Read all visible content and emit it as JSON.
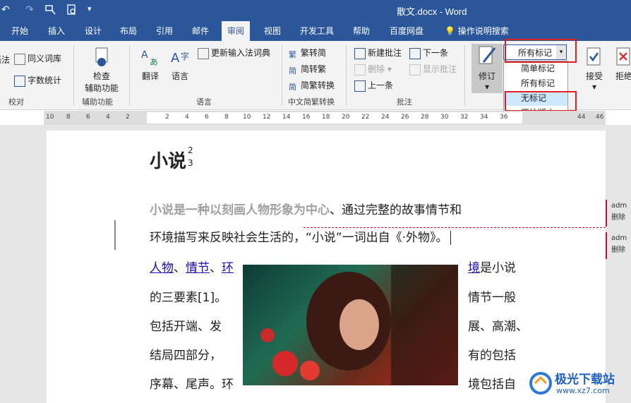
{
  "titlebar": {
    "undo": "↶",
    "redo": "↷",
    "doc_title": "散文.docx  -  Word"
  },
  "tabs": [
    "开始",
    "插入",
    "设计",
    "布局",
    "引用",
    "邮件",
    "审阅",
    "视图",
    "开发工具",
    "帮助",
    "百度网盘",
    "操作说明搜索"
  ],
  "ribbon": {
    "proofing": {
      "thesaurus": "同义词库",
      "wordcount": "字数统计",
      "grammar": "语法",
      "group": "校对"
    },
    "accessibility": {
      "check": "检查",
      "check2": "辅助功能",
      "group": "辅助功能"
    },
    "language": {
      "translate": "翻译",
      "language": "语言",
      "ime": "更新输入法词典",
      "group": "语言"
    },
    "chinese": {
      "t2s": "繁转简",
      "s2t": "简转繁",
      "convert": "简繁转换",
      "group": "中文简繁转换"
    },
    "comments": {
      "new": "新建批注",
      "delete": "删除",
      "prev": "上一条",
      "next": "下一条",
      "show": "显示批注",
      "group": "批注"
    },
    "tracking": {
      "track": "修订",
      "select_value": "所有标记",
      "simple": "简单标记",
      "all": "所有标记",
      "none": "无标记",
      "original": "原始版本",
      "partial": "修"
    },
    "changes": {
      "accept": "接受",
      "reject": "拒绝"
    }
  },
  "ruler": [
    "10",
    "8",
    "6",
    "4",
    "2",
    "2",
    "4",
    "6",
    "8",
    "10",
    "12",
    "14",
    "16",
    "18",
    "20",
    "22",
    "24",
    "26",
    "28",
    "30",
    "32",
    "34",
    "36",
    "44",
    "46"
  ],
  "document": {
    "title": "小说",
    "sup": "2",
    "sub": "3",
    "deleted": "小说是一种以刻画人物形象为中心",
    "line1_rest": "、通过完整的故事情节和",
    "line2": "环境描写来反映社会生活的，“小说”一词出自《·外物》。",
    "link1": "人物",
    "sep1": "、",
    "link2": "情节",
    "sep2": "、",
    "link3": "环",
    "link3b": "境",
    "right1": "是小说",
    "left2": "的三要素[1]。",
    "right2": "情节一般",
    "left3": "包括开端、发",
    "right3": "展、高潮、",
    "left4": "结局四部分，",
    "right4": "有的包括",
    "left5": "序幕、尾声。环",
    "right5": "境包括自"
  },
  "comments": [
    {
      "author": "adm",
      "action": "删除"
    },
    {
      "author": "adm",
      "action": "删除"
    }
  ],
  "watermark": {
    "name": "极光下载站",
    "url": "www.xz7.com"
  }
}
